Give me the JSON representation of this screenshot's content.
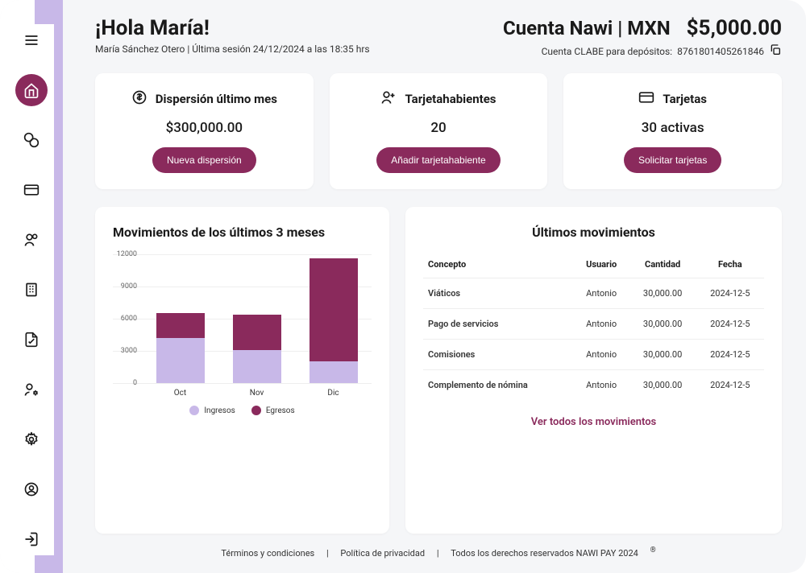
{
  "greeting": {
    "title": "¡Hola María!",
    "subtitle": "María Sánchez Otero | Última sesión 24/12/2024 a las 18:35 hrs"
  },
  "account": {
    "title": "Cuenta Nawi | MXN",
    "balance": "$5,000.00",
    "clabe_label": "Cuenta CLABE para depósitos:",
    "clabe": "8761801405261846"
  },
  "stat_cards": {
    "dispersion": {
      "title": "Dispersión último mes",
      "value": "$300,000.00",
      "button": "Nueva dispersión"
    },
    "holders": {
      "title": "Tarjetahabientes",
      "value": "20",
      "button": "Añadir tarjetahabiente"
    },
    "cards": {
      "title": "Tarjetas",
      "value": "30 activas",
      "button": "Solicitar tarjetas"
    }
  },
  "chart_panel_title": "Movimientos de los últimos 3 meses",
  "chart_data": {
    "type": "bar",
    "title": "Movimientos de los últimos 3 meses",
    "categories": [
      "Oct",
      "Nov",
      "Dic"
    ],
    "series": [
      {
        "name": "Ingresos",
        "color": "#c8b8e8",
        "values": [
          4200,
          3100,
          2000
        ]
      },
      {
        "name": "Egresos",
        "color": "#8a2a5c",
        "values": [
          2300,
          3300,
          9600
        ]
      }
    ],
    "ylim": [
      0,
      12000
    ],
    "yticks": [
      0,
      3000,
      6000,
      9000,
      12000
    ],
    "ylabel": "",
    "xlabel": "",
    "legend": [
      "Ingresos",
      "Egresos"
    ]
  },
  "movements": {
    "title": "Últimos movimientos",
    "headers": [
      "Concepto",
      "Usuario",
      "Cantidad",
      "Fecha"
    ],
    "rows": [
      {
        "concepto": "Viáticos",
        "usuario": "Antonio",
        "cantidad": "30,000.00",
        "fecha": "2024-12-5"
      },
      {
        "concepto": "Pago de servicios",
        "usuario": "Antonio",
        "cantidad": "30,000.00",
        "fecha": "2024-12-5"
      },
      {
        "concepto": "Comisiones",
        "usuario": "Antonio",
        "cantidad": "30,000.00",
        "fecha": "2024-12-5"
      },
      {
        "concepto": "Complemento de nómina",
        "usuario": "Antonio",
        "cantidad": "30,000.00",
        "fecha": "2024-12-5"
      }
    ],
    "see_all": "Ver todos los movimientos"
  },
  "footer": {
    "terms": "Términos y condiciones",
    "privacy": "Política de privacidad",
    "rights": "Todos los derechos reservados NAWI PAY 2024"
  },
  "legend_labels": {
    "ingresos": "Ingresos",
    "egresos": "Egresos"
  }
}
